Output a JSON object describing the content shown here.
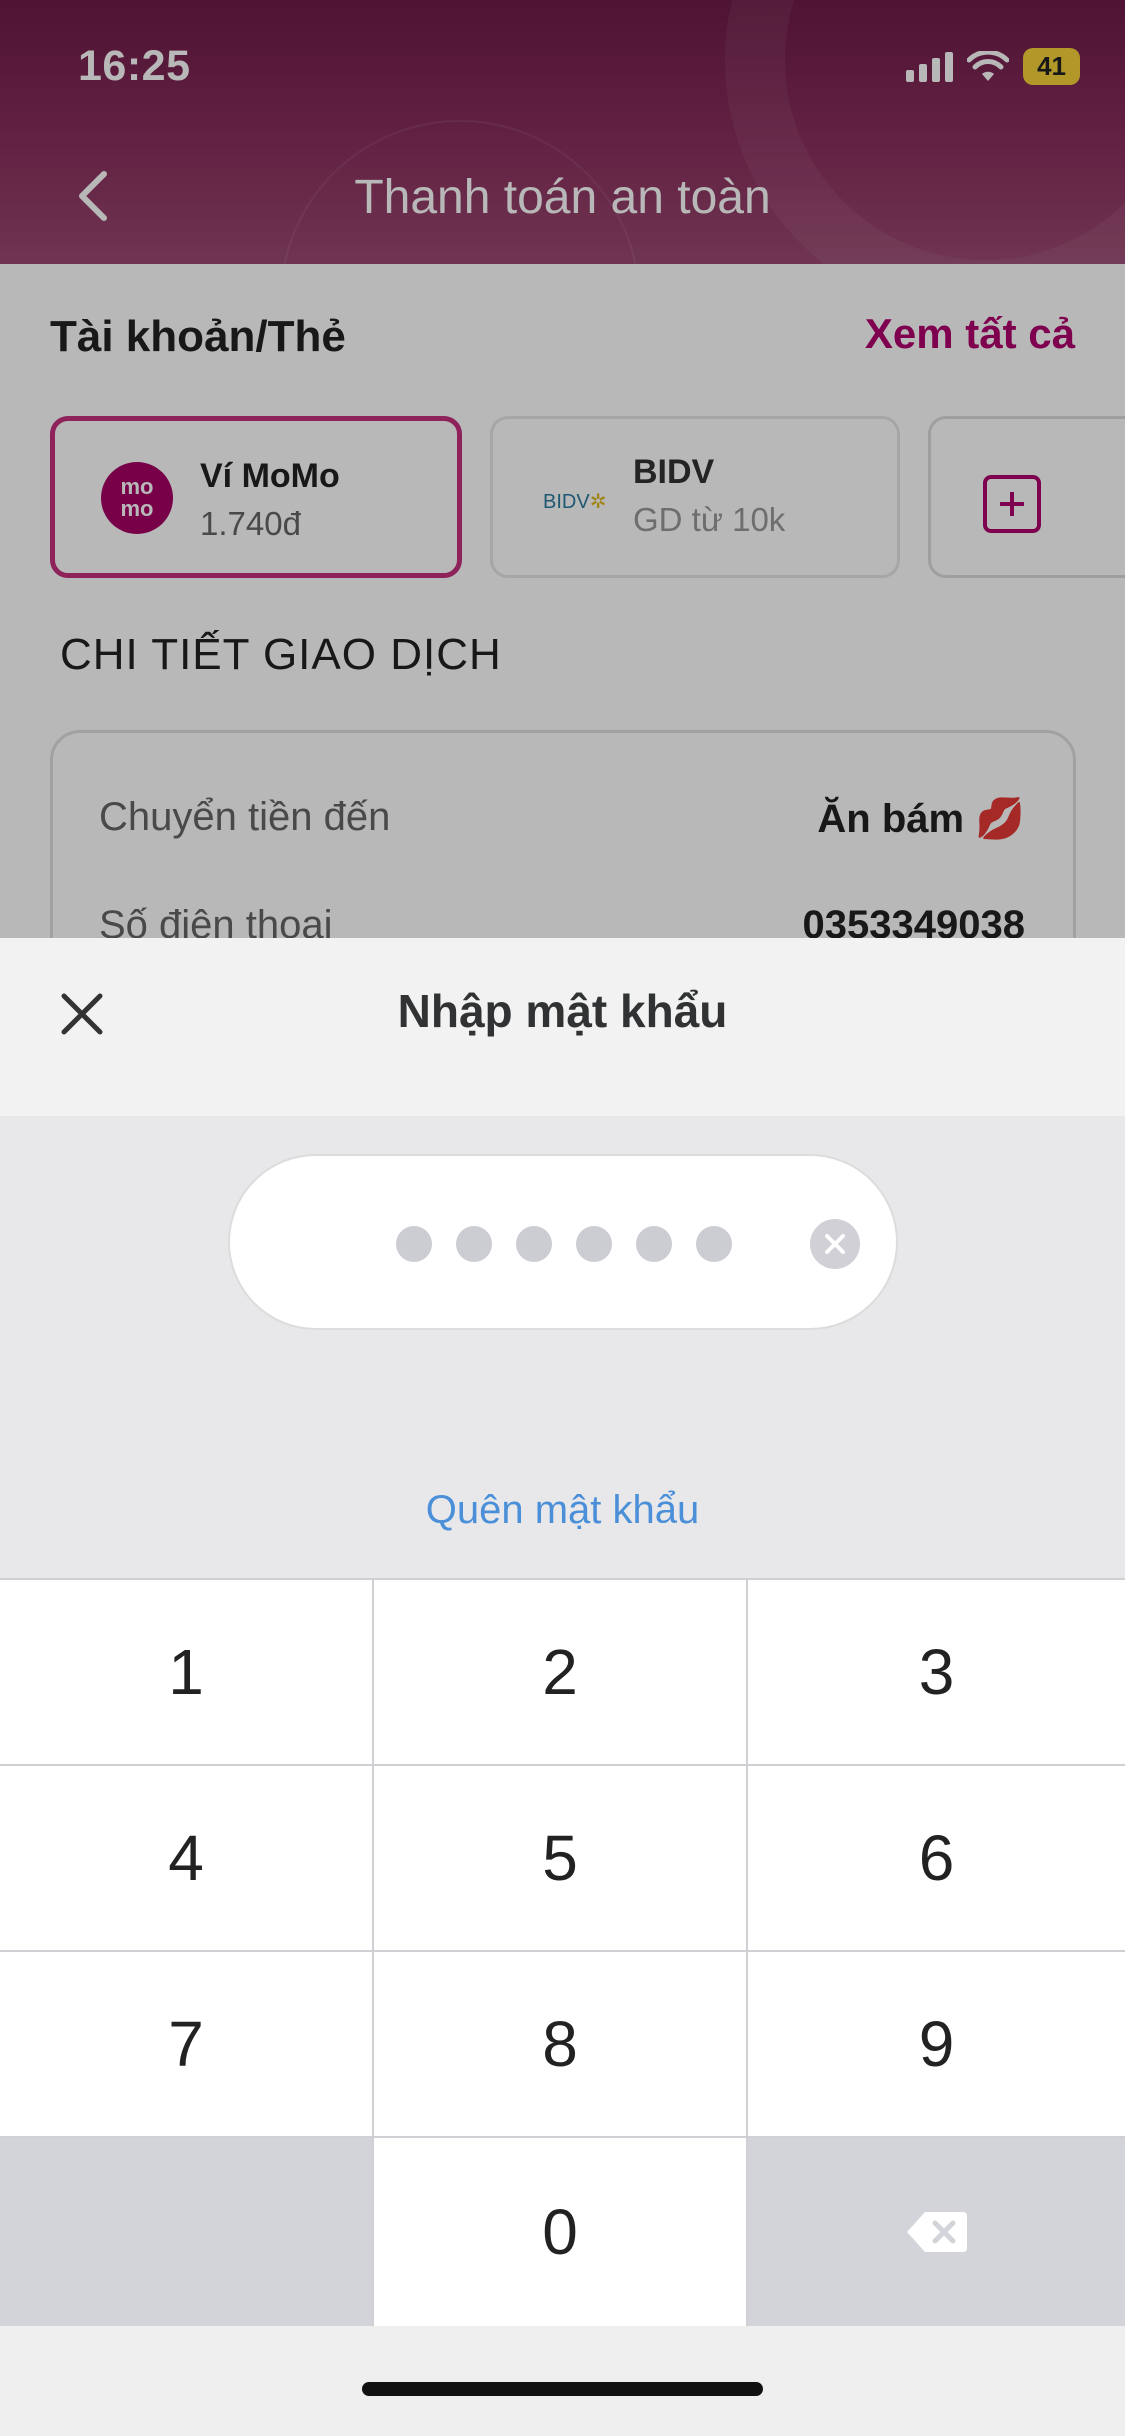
{
  "status_bar": {
    "time": "16:25",
    "battery": "41"
  },
  "header": {
    "title": "Thanh toán an toàn"
  },
  "accounts": {
    "title": "Tài khoản/Thẻ",
    "see_all": "Xem tất cả",
    "cards": [
      {
        "logo": "mo mo",
        "name": "Ví MoMo",
        "sub": "1.740đ"
      },
      {
        "logo": "BIDV",
        "name": "BIDV",
        "sub": "GD từ 10k"
      }
    ]
  },
  "details": {
    "section_title": "CHI TIẾT GIAO DỊCH",
    "rows": [
      {
        "label": "Chuyển tiền đến",
        "value": "Ăn bám 💋"
      },
      {
        "label": "Số điện thoại",
        "value": "0353349038"
      }
    ]
  },
  "password_sheet": {
    "title": "Nhập mật khẩu",
    "pin_length": 6,
    "forgot_label": "Quên mật khẩu"
  },
  "keypad": {
    "keys": [
      "1",
      "2",
      "3",
      "4",
      "5",
      "6",
      "7",
      "8",
      "9",
      "0"
    ]
  },
  "colors": {
    "brand": "#a50064",
    "link": "#4a8fd8",
    "battery": "#f6d33a"
  }
}
